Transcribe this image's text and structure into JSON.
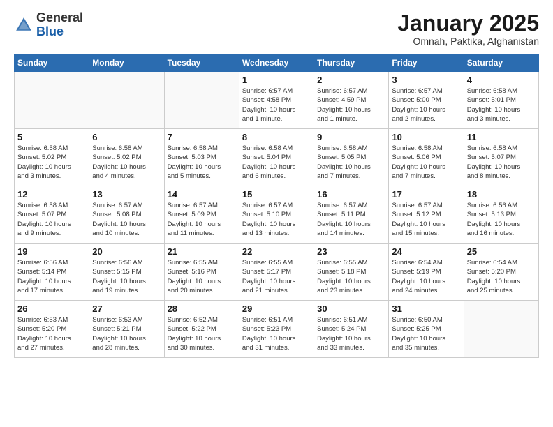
{
  "header": {
    "logo_general": "General",
    "logo_blue": "Blue",
    "title": "January 2025",
    "subtitle": "Omnah, Paktika, Afghanistan"
  },
  "weekdays": [
    "Sunday",
    "Monday",
    "Tuesday",
    "Wednesday",
    "Thursday",
    "Friday",
    "Saturday"
  ],
  "weeks": [
    [
      {
        "day": "",
        "info": ""
      },
      {
        "day": "",
        "info": ""
      },
      {
        "day": "",
        "info": ""
      },
      {
        "day": "1",
        "info": "Sunrise: 6:57 AM\nSunset: 4:58 PM\nDaylight: 10 hours\nand 1 minute."
      },
      {
        "day": "2",
        "info": "Sunrise: 6:57 AM\nSunset: 4:59 PM\nDaylight: 10 hours\nand 1 minute."
      },
      {
        "day": "3",
        "info": "Sunrise: 6:57 AM\nSunset: 5:00 PM\nDaylight: 10 hours\nand 2 minutes."
      },
      {
        "day": "4",
        "info": "Sunrise: 6:58 AM\nSunset: 5:01 PM\nDaylight: 10 hours\nand 3 minutes."
      }
    ],
    [
      {
        "day": "5",
        "info": "Sunrise: 6:58 AM\nSunset: 5:02 PM\nDaylight: 10 hours\nand 3 minutes."
      },
      {
        "day": "6",
        "info": "Sunrise: 6:58 AM\nSunset: 5:02 PM\nDaylight: 10 hours\nand 4 minutes."
      },
      {
        "day": "7",
        "info": "Sunrise: 6:58 AM\nSunset: 5:03 PM\nDaylight: 10 hours\nand 5 minutes."
      },
      {
        "day": "8",
        "info": "Sunrise: 6:58 AM\nSunset: 5:04 PM\nDaylight: 10 hours\nand 6 minutes."
      },
      {
        "day": "9",
        "info": "Sunrise: 6:58 AM\nSunset: 5:05 PM\nDaylight: 10 hours\nand 7 minutes."
      },
      {
        "day": "10",
        "info": "Sunrise: 6:58 AM\nSunset: 5:06 PM\nDaylight: 10 hours\nand 7 minutes."
      },
      {
        "day": "11",
        "info": "Sunrise: 6:58 AM\nSunset: 5:07 PM\nDaylight: 10 hours\nand 8 minutes."
      }
    ],
    [
      {
        "day": "12",
        "info": "Sunrise: 6:58 AM\nSunset: 5:07 PM\nDaylight: 10 hours\nand 9 minutes."
      },
      {
        "day": "13",
        "info": "Sunrise: 6:57 AM\nSunset: 5:08 PM\nDaylight: 10 hours\nand 10 minutes."
      },
      {
        "day": "14",
        "info": "Sunrise: 6:57 AM\nSunset: 5:09 PM\nDaylight: 10 hours\nand 11 minutes."
      },
      {
        "day": "15",
        "info": "Sunrise: 6:57 AM\nSunset: 5:10 PM\nDaylight: 10 hours\nand 13 minutes."
      },
      {
        "day": "16",
        "info": "Sunrise: 6:57 AM\nSunset: 5:11 PM\nDaylight: 10 hours\nand 14 minutes."
      },
      {
        "day": "17",
        "info": "Sunrise: 6:57 AM\nSunset: 5:12 PM\nDaylight: 10 hours\nand 15 minutes."
      },
      {
        "day": "18",
        "info": "Sunrise: 6:56 AM\nSunset: 5:13 PM\nDaylight: 10 hours\nand 16 minutes."
      }
    ],
    [
      {
        "day": "19",
        "info": "Sunrise: 6:56 AM\nSunset: 5:14 PM\nDaylight: 10 hours\nand 17 minutes."
      },
      {
        "day": "20",
        "info": "Sunrise: 6:56 AM\nSunset: 5:15 PM\nDaylight: 10 hours\nand 19 minutes."
      },
      {
        "day": "21",
        "info": "Sunrise: 6:55 AM\nSunset: 5:16 PM\nDaylight: 10 hours\nand 20 minutes."
      },
      {
        "day": "22",
        "info": "Sunrise: 6:55 AM\nSunset: 5:17 PM\nDaylight: 10 hours\nand 21 minutes."
      },
      {
        "day": "23",
        "info": "Sunrise: 6:55 AM\nSunset: 5:18 PM\nDaylight: 10 hours\nand 23 minutes."
      },
      {
        "day": "24",
        "info": "Sunrise: 6:54 AM\nSunset: 5:19 PM\nDaylight: 10 hours\nand 24 minutes."
      },
      {
        "day": "25",
        "info": "Sunrise: 6:54 AM\nSunset: 5:20 PM\nDaylight: 10 hours\nand 25 minutes."
      }
    ],
    [
      {
        "day": "26",
        "info": "Sunrise: 6:53 AM\nSunset: 5:20 PM\nDaylight: 10 hours\nand 27 minutes."
      },
      {
        "day": "27",
        "info": "Sunrise: 6:53 AM\nSunset: 5:21 PM\nDaylight: 10 hours\nand 28 minutes."
      },
      {
        "day": "28",
        "info": "Sunrise: 6:52 AM\nSunset: 5:22 PM\nDaylight: 10 hours\nand 30 minutes."
      },
      {
        "day": "29",
        "info": "Sunrise: 6:51 AM\nSunset: 5:23 PM\nDaylight: 10 hours\nand 31 minutes."
      },
      {
        "day": "30",
        "info": "Sunrise: 6:51 AM\nSunset: 5:24 PM\nDaylight: 10 hours\nand 33 minutes."
      },
      {
        "day": "31",
        "info": "Sunrise: 6:50 AM\nSunset: 5:25 PM\nDaylight: 10 hours\nand 35 minutes."
      },
      {
        "day": "",
        "info": ""
      }
    ]
  ]
}
